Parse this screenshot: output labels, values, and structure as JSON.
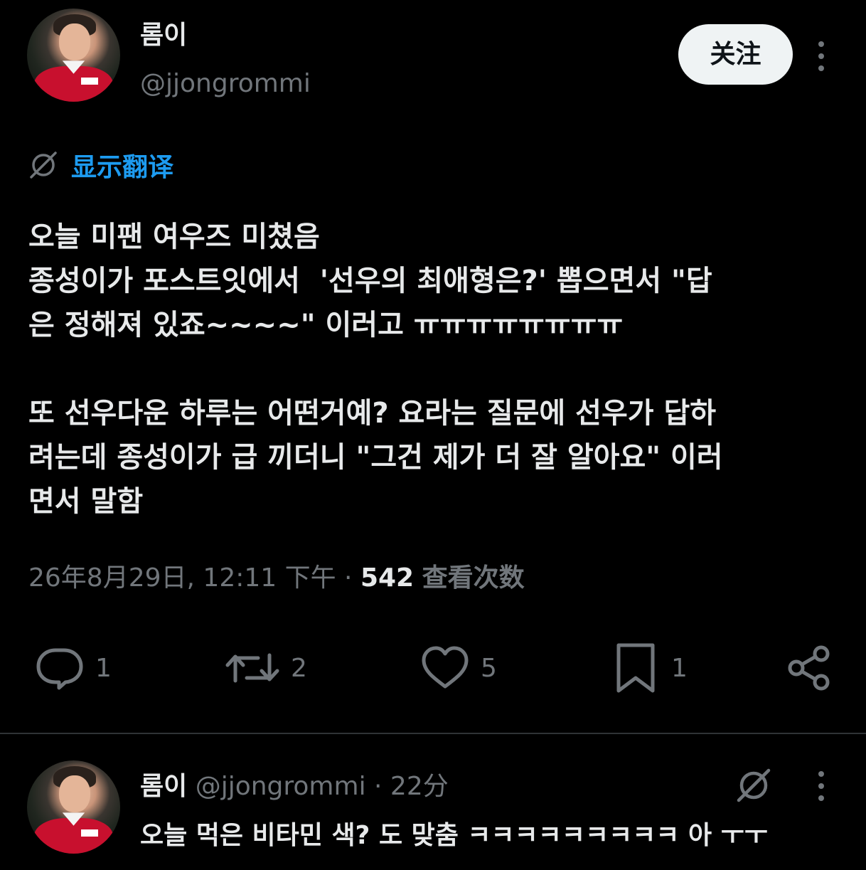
{
  "tweet": {
    "author": {
      "display_name": "롬이",
      "handle": "@jjongrommi"
    },
    "follow_label": "关注",
    "translate_label": "显示翻译",
    "text": "오늘 미팬 여우즈 미쳤음\n종성이가 포스트잇에서  '선우의 최애형은?' 뽑으면서 \"답\n은 정해져 있죠~~~~\" 이러고 ㅠㅠㅠㅠㅠㅠㅠㅠ\n\n또 선우다운 하루는 어떤거예? 요라는 질문에 선우가 답하\n려는데 종성이가 급 끼더니 \"그건 제가 더 잘 알아요\" 이러\n면서 말함",
    "timestamp": "26年8月29日, 12:11 下午",
    "separator": " · ",
    "views_count": "542",
    "views_label": "查看次数",
    "actions": {
      "replies": "1",
      "retweets": "2",
      "likes": "5",
      "bookmarks": "1"
    }
  },
  "reply": {
    "display_name": "롬이",
    "handle": "@jjongrommi",
    "separator": " · ",
    "time": "22分",
    "text": "오늘 먹은 비타민 색? 도 맞춤 ㅋㅋㅋㅋㅋㅋㅋㅋㅋ 아 ㅜㅜ"
  },
  "icons": {
    "translate": "translate-globe-icon",
    "reply": "reply-bubble-icon",
    "retweet": "retweet-icon",
    "like": "heart-icon",
    "bookmark": "bookmark-icon",
    "share": "share-icon",
    "more": "more-vertical-icon"
  },
  "colors": {
    "background": "#000000",
    "text_primary": "#e7e9ea",
    "text_secondary": "#71767b",
    "accent": "#1d9bf0",
    "divider": "#2f3336",
    "follow_button_bg": "#eff3f4"
  }
}
